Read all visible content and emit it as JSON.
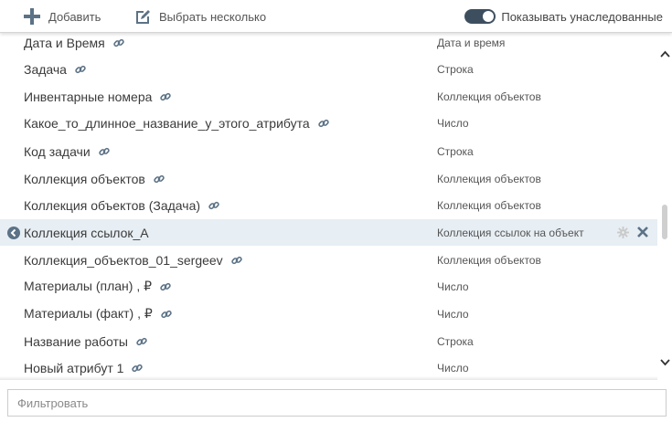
{
  "toolbar": {
    "add_label": "Добавить",
    "select_multiple_label": "Выбрать несколько",
    "show_inherited_label": "Показывать унаследованные",
    "show_inherited_on": true
  },
  "attributes": [
    {
      "name": "Дата и Время",
      "type": "Дата и время"
    },
    {
      "name": "Задача",
      "type": "Строка"
    },
    {
      "name": "Инвентарные номера",
      "type": "Коллекция объектов"
    },
    {
      "name": "Какое_то_длинное_название_у_этого_атрибута",
      "type": "Число"
    },
    {
      "name": "Код задачи",
      "type": "Строка"
    },
    {
      "name": "Коллекция объектов",
      "type": "Коллекция объектов"
    },
    {
      "name": "Коллекция объектов (Задача)",
      "type": "Коллекция объектов"
    },
    {
      "name": "Коллекция ссылок_А",
      "type": "Коллекция ссылок на объект",
      "selected": true
    },
    {
      "name": "Коллекция_объектов_01_sergeev",
      "type": "Коллекция объектов"
    },
    {
      "name": "Материалы (план) , ₽",
      "type": "Число"
    },
    {
      "name": "Материалы (факт) , ₽",
      "type": "Число"
    },
    {
      "name": "Название работы",
      "type": "Строка"
    },
    {
      "name": "Новый атрибут 1",
      "type": "Число"
    }
  ],
  "filter": {
    "placeholder": "Фильтровать",
    "value": ""
  },
  "icons": {
    "add": "plus-icon",
    "select_multiple": "edit-icon",
    "inherited_link": "link-icon",
    "selected_row": "arrow-left-circle-icon",
    "settings": "gear-icon",
    "remove": "close-icon"
  },
  "colors": {
    "icon": "#5c7286",
    "selected_row_bg": "#e7eef4",
    "toggle_on": "#3d4f5f"
  }
}
